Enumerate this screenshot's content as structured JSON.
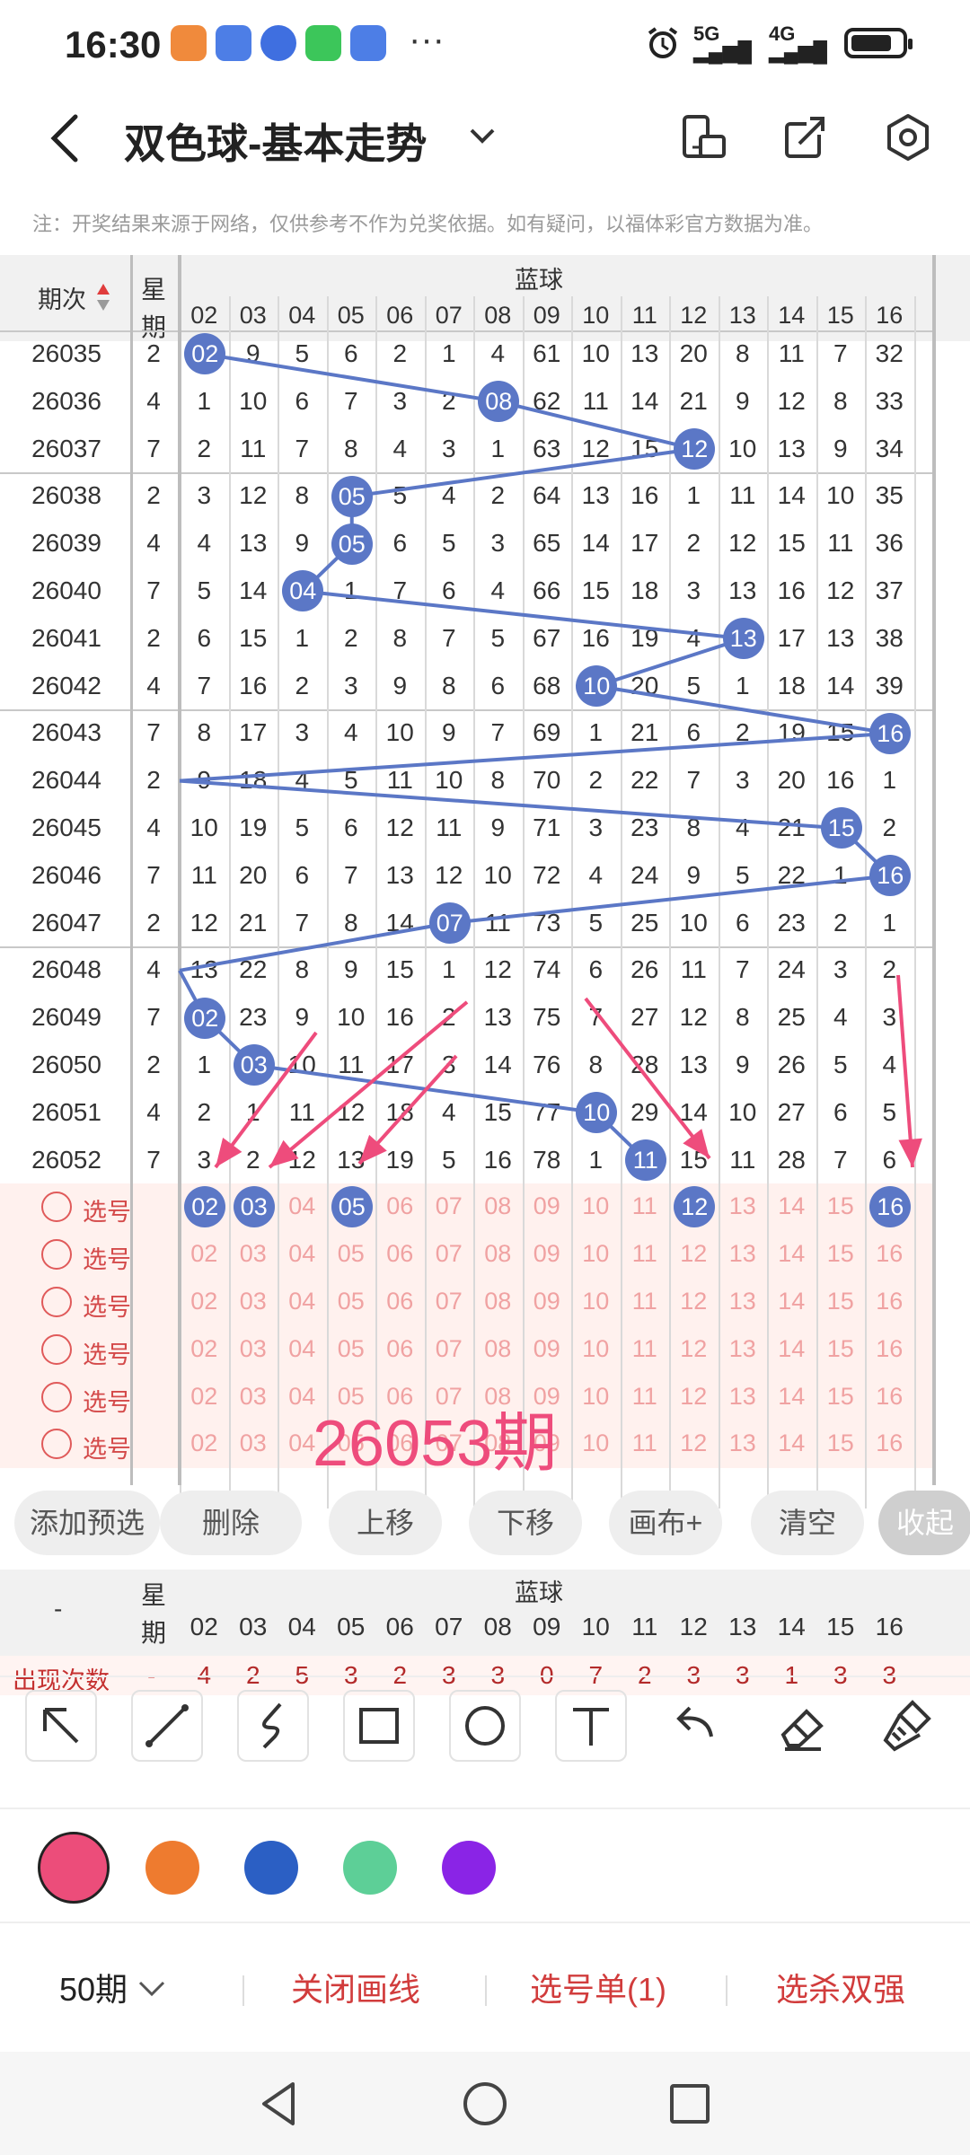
{
  "status_bar": {
    "time": "16:30",
    "more": "···",
    "net_5g": "5G",
    "net_4g": "4G"
  },
  "header": {
    "title": "双色球-基本走势"
  },
  "notice": "注：开奖结果来源于网络，仅供参考不作为兑奖依据。如有疑问，以福体彩官方数据为准。",
  "table": {
    "col_period": "期次",
    "col_week": "星期",
    "col_group": "蓝球",
    "columns": [
      "02",
      "03",
      "04",
      "05",
      "06",
      "07",
      "08",
      "09",
      "10",
      "11",
      "12",
      "13",
      "14",
      "15",
      "16"
    ],
    "rows": [
      {
        "period": "26035",
        "week": "2",
        "cells": [
          "02",
          "9",
          "5",
          "6",
          "2",
          "1",
          "4",
          "61",
          "10",
          "13",
          "20",
          "8",
          "11",
          "7",
          "32"
        ],
        "ball": 0
      },
      {
        "period": "26036",
        "week": "4",
        "cells": [
          "1",
          "10",
          "6",
          "7",
          "3",
          "2",
          "08",
          "62",
          "11",
          "14",
          "21",
          "9",
          "12",
          "8",
          "33"
        ],
        "ball": 6
      },
      {
        "period": "26037",
        "week": "7",
        "cells": [
          "2",
          "11",
          "7",
          "8",
          "4",
          "3",
          "1",
          "63",
          "12",
          "15",
          "12",
          "10",
          "13",
          "9",
          "34"
        ],
        "ball": 10
      },
      {
        "period": "26038",
        "week": "2",
        "cells": [
          "3",
          "12",
          "8",
          "05",
          "5",
          "4",
          "2",
          "64",
          "13",
          "16",
          "1",
          "11",
          "14",
          "10",
          "35"
        ],
        "ball": 3
      },
      {
        "period": "26039",
        "week": "4",
        "cells": [
          "4",
          "13",
          "9",
          "05",
          "6",
          "5",
          "3",
          "65",
          "14",
          "17",
          "2",
          "12",
          "15",
          "11",
          "36"
        ],
        "ball": 3
      },
      {
        "period": "26040",
        "week": "7",
        "cells": [
          "5",
          "14",
          "04",
          "1",
          "7",
          "6",
          "4",
          "66",
          "15",
          "18",
          "3",
          "13",
          "16",
          "12",
          "37"
        ],
        "ball": 2
      },
      {
        "period": "26041",
        "week": "2",
        "cells": [
          "6",
          "15",
          "1",
          "2",
          "8",
          "7",
          "5",
          "67",
          "16",
          "19",
          "4",
          "13",
          "17",
          "13",
          "38"
        ],
        "ball": 11
      },
      {
        "period": "26042",
        "week": "4",
        "cells": [
          "7",
          "16",
          "2",
          "3",
          "9",
          "8",
          "6",
          "68",
          "10",
          "20",
          "5",
          "1",
          "18",
          "14",
          "39"
        ],
        "ball": 8
      },
      {
        "period": "26043",
        "week": "7",
        "cells": [
          "8",
          "17",
          "3",
          "4",
          "10",
          "9",
          "7",
          "69",
          "1",
          "21",
          "6",
          "2",
          "19",
          "15",
          "16"
        ],
        "ball": 14
      },
      {
        "period": "26044",
        "week": "2",
        "cells": [
          "9",
          "18",
          "4",
          "5",
          "11",
          "10",
          "8",
          "70",
          "2",
          "22",
          "7",
          "3",
          "20",
          "16",
          "1"
        ],
        "ball": -1
      },
      {
        "period": "26045",
        "week": "4",
        "cells": [
          "10",
          "19",
          "5",
          "6",
          "12",
          "11",
          "9",
          "71",
          "3",
          "23",
          "8",
          "4",
          "21",
          "15",
          "2"
        ],
        "ball": 13
      },
      {
        "period": "26046",
        "week": "7",
        "cells": [
          "11",
          "20",
          "6",
          "7",
          "13",
          "12",
          "10",
          "72",
          "4",
          "24",
          "9",
          "5",
          "22",
          "1",
          "16"
        ],
        "ball": 14
      },
      {
        "period": "26047",
        "week": "2",
        "cells": [
          "12",
          "21",
          "7",
          "8",
          "14",
          "07",
          "11",
          "73",
          "5",
          "25",
          "10",
          "6",
          "23",
          "2",
          "1"
        ],
        "ball": 5
      },
      {
        "period": "26048",
        "week": "4",
        "cells": [
          "13",
          "22",
          "8",
          "9",
          "15",
          "1",
          "12",
          "74",
          "6",
          "26",
          "11",
          "7",
          "24",
          "3",
          "2"
        ],
        "ball": -1
      },
      {
        "period": "26049",
        "week": "7",
        "cells": [
          "02",
          "23",
          "9",
          "10",
          "16",
          "2",
          "13",
          "75",
          "7",
          "27",
          "12",
          "8",
          "25",
          "4",
          "3"
        ],
        "ball": 0
      },
      {
        "period": "26050",
        "week": "2",
        "cells": [
          "1",
          "03",
          "10",
          "11",
          "17",
          "3",
          "14",
          "76",
          "8",
          "28",
          "13",
          "9",
          "26",
          "5",
          "4"
        ],
        "ball": 1
      },
      {
        "period": "26051",
        "week": "4",
        "cells": [
          "2",
          "1",
          "11",
          "12",
          "18",
          "4",
          "15",
          "77",
          "10",
          "29",
          "14",
          "10",
          "27",
          "6",
          "5"
        ],
        "ball": 8
      },
      {
        "period": "26052",
        "week": "7",
        "cells": [
          "3",
          "2",
          "12",
          "13",
          "19",
          "5",
          "16",
          "78",
          "1",
          "11",
          "15",
          "11",
          "28",
          "7",
          "6"
        ],
        "ball": 9
      }
    ],
    "pick_label": "选号",
    "pick_rows": 6,
    "selected_first_row": [
      "02",
      "03",
      "05",
      "12",
      "16"
    ]
  },
  "watermark": "26053期",
  "actions": [
    "添加预选",
    "删除",
    "上移",
    "下移",
    "画布+",
    "清空",
    "收起"
  ],
  "stats": {
    "dash": "-",
    "label": "出现次数",
    "values": [
      "4",
      "2",
      "5",
      "3",
      "2",
      "3",
      "3",
      "0",
      "7",
      "2",
      "3",
      "3",
      "1",
      "3",
      "3"
    ]
  },
  "pen_colors": [
    "#ec4d7a",
    "#ee7b2f",
    "#2b5fc4",
    "#5dcf97",
    "#8a24e6"
  ],
  "bottom": {
    "periods": "50期",
    "close_line": "关闭画线",
    "pick_list": "选号单(1)",
    "kill": "选杀双强"
  },
  "accent": "#d13c3c"
}
